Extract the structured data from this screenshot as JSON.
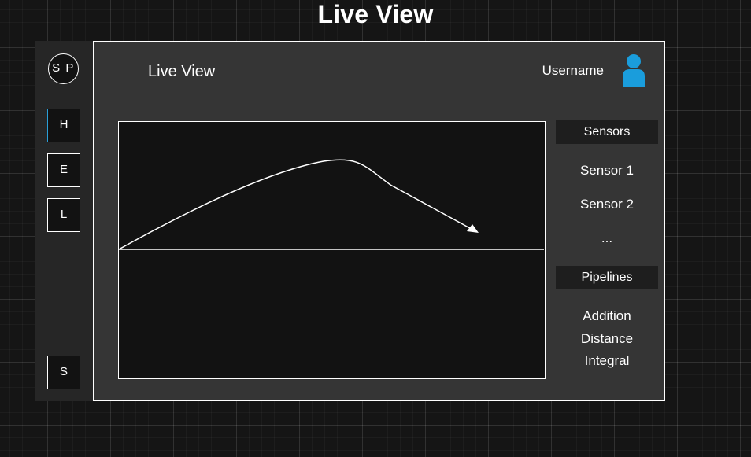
{
  "page": {
    "title": "Live View"
  },
  "sidebar": {
    "logo": "S P",
    "nav": [
      {
        "label": "H",
        "active": true
      },
      {
        "label": "E",
        "active": false
      },
      {
        "label": "L",
        "active": false
      }
    ],
    "bottom_button": "S"
  },
  "header": {
    "title": "Live View",
    "username": "Username",
    "user_icon": "user-silhouette-icon"
  },
  "sensors": {
    "header": "Sensors",
    "items": [
      "Sensor 1",
      "Sensor 2"
    ],
    "more": "..."
  },
  "pipelines": {
    "header": "Pipelines",
    "items": [
      "Addition",
      "Distance",
      "Integral"
    ]
  },
  "colors": {
    "accent": "#2a9fd8",
    "user_icon": "#1a9ddc",
    "background": "#151515",
    "panel": "#353535",
    "sidebar": "#262626",
    "graph": "#121212"
  }
}
